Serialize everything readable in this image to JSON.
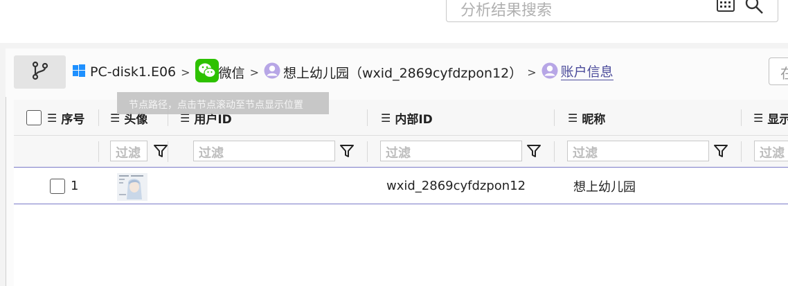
{
  "search": {
    "placeholder": "分析结果搜索"
  },
  "breadcrumb": {
    "items": [
      {
        "label": "PC-disk1.E06",
        "icon": "windows-icon"
      },
      {
        "label": "微信",
        "icon": "wechat-icon"
      },
      {
        "label": "想上幼儿园（wxid_2869cyfdzpon12）",
        "icon": "user-icon"
      },
      {
        "label": "账户信息",
        "icon": "user-icon"
      }
    ],
    "separator": ">"
  },
  "right_button": {
    "label": "在"
  },
  "tooltip": {
    "text": "节点路径，点击节点滚动至节点显示位置"
  },
  "table": {
    "columns": [
      {
        "label": "序号"
      },
      {
        "label": "头像"
      },
      {
        "label": "用户ID"
      },
      {
        "label": "内部ID"
      },
      {
        "label": "昵称"
      },
      {
        "label": "显示"
      }
    ],
    "filter_placeholder": "过滤",
    "rows": [
      {
        "index": "1",
        "user_id": "",
        "internal_id": "wxid_2869cyfdzpon12",
        "nickname": "想上幼儿园"
      }
    ]
  },
  "colors": {
    "accent": "#7a7ac8",
    "link": "#4a4a9a",
    "wechat": "#2dc100",
    "windows": "#1e90ff"
  }
}
